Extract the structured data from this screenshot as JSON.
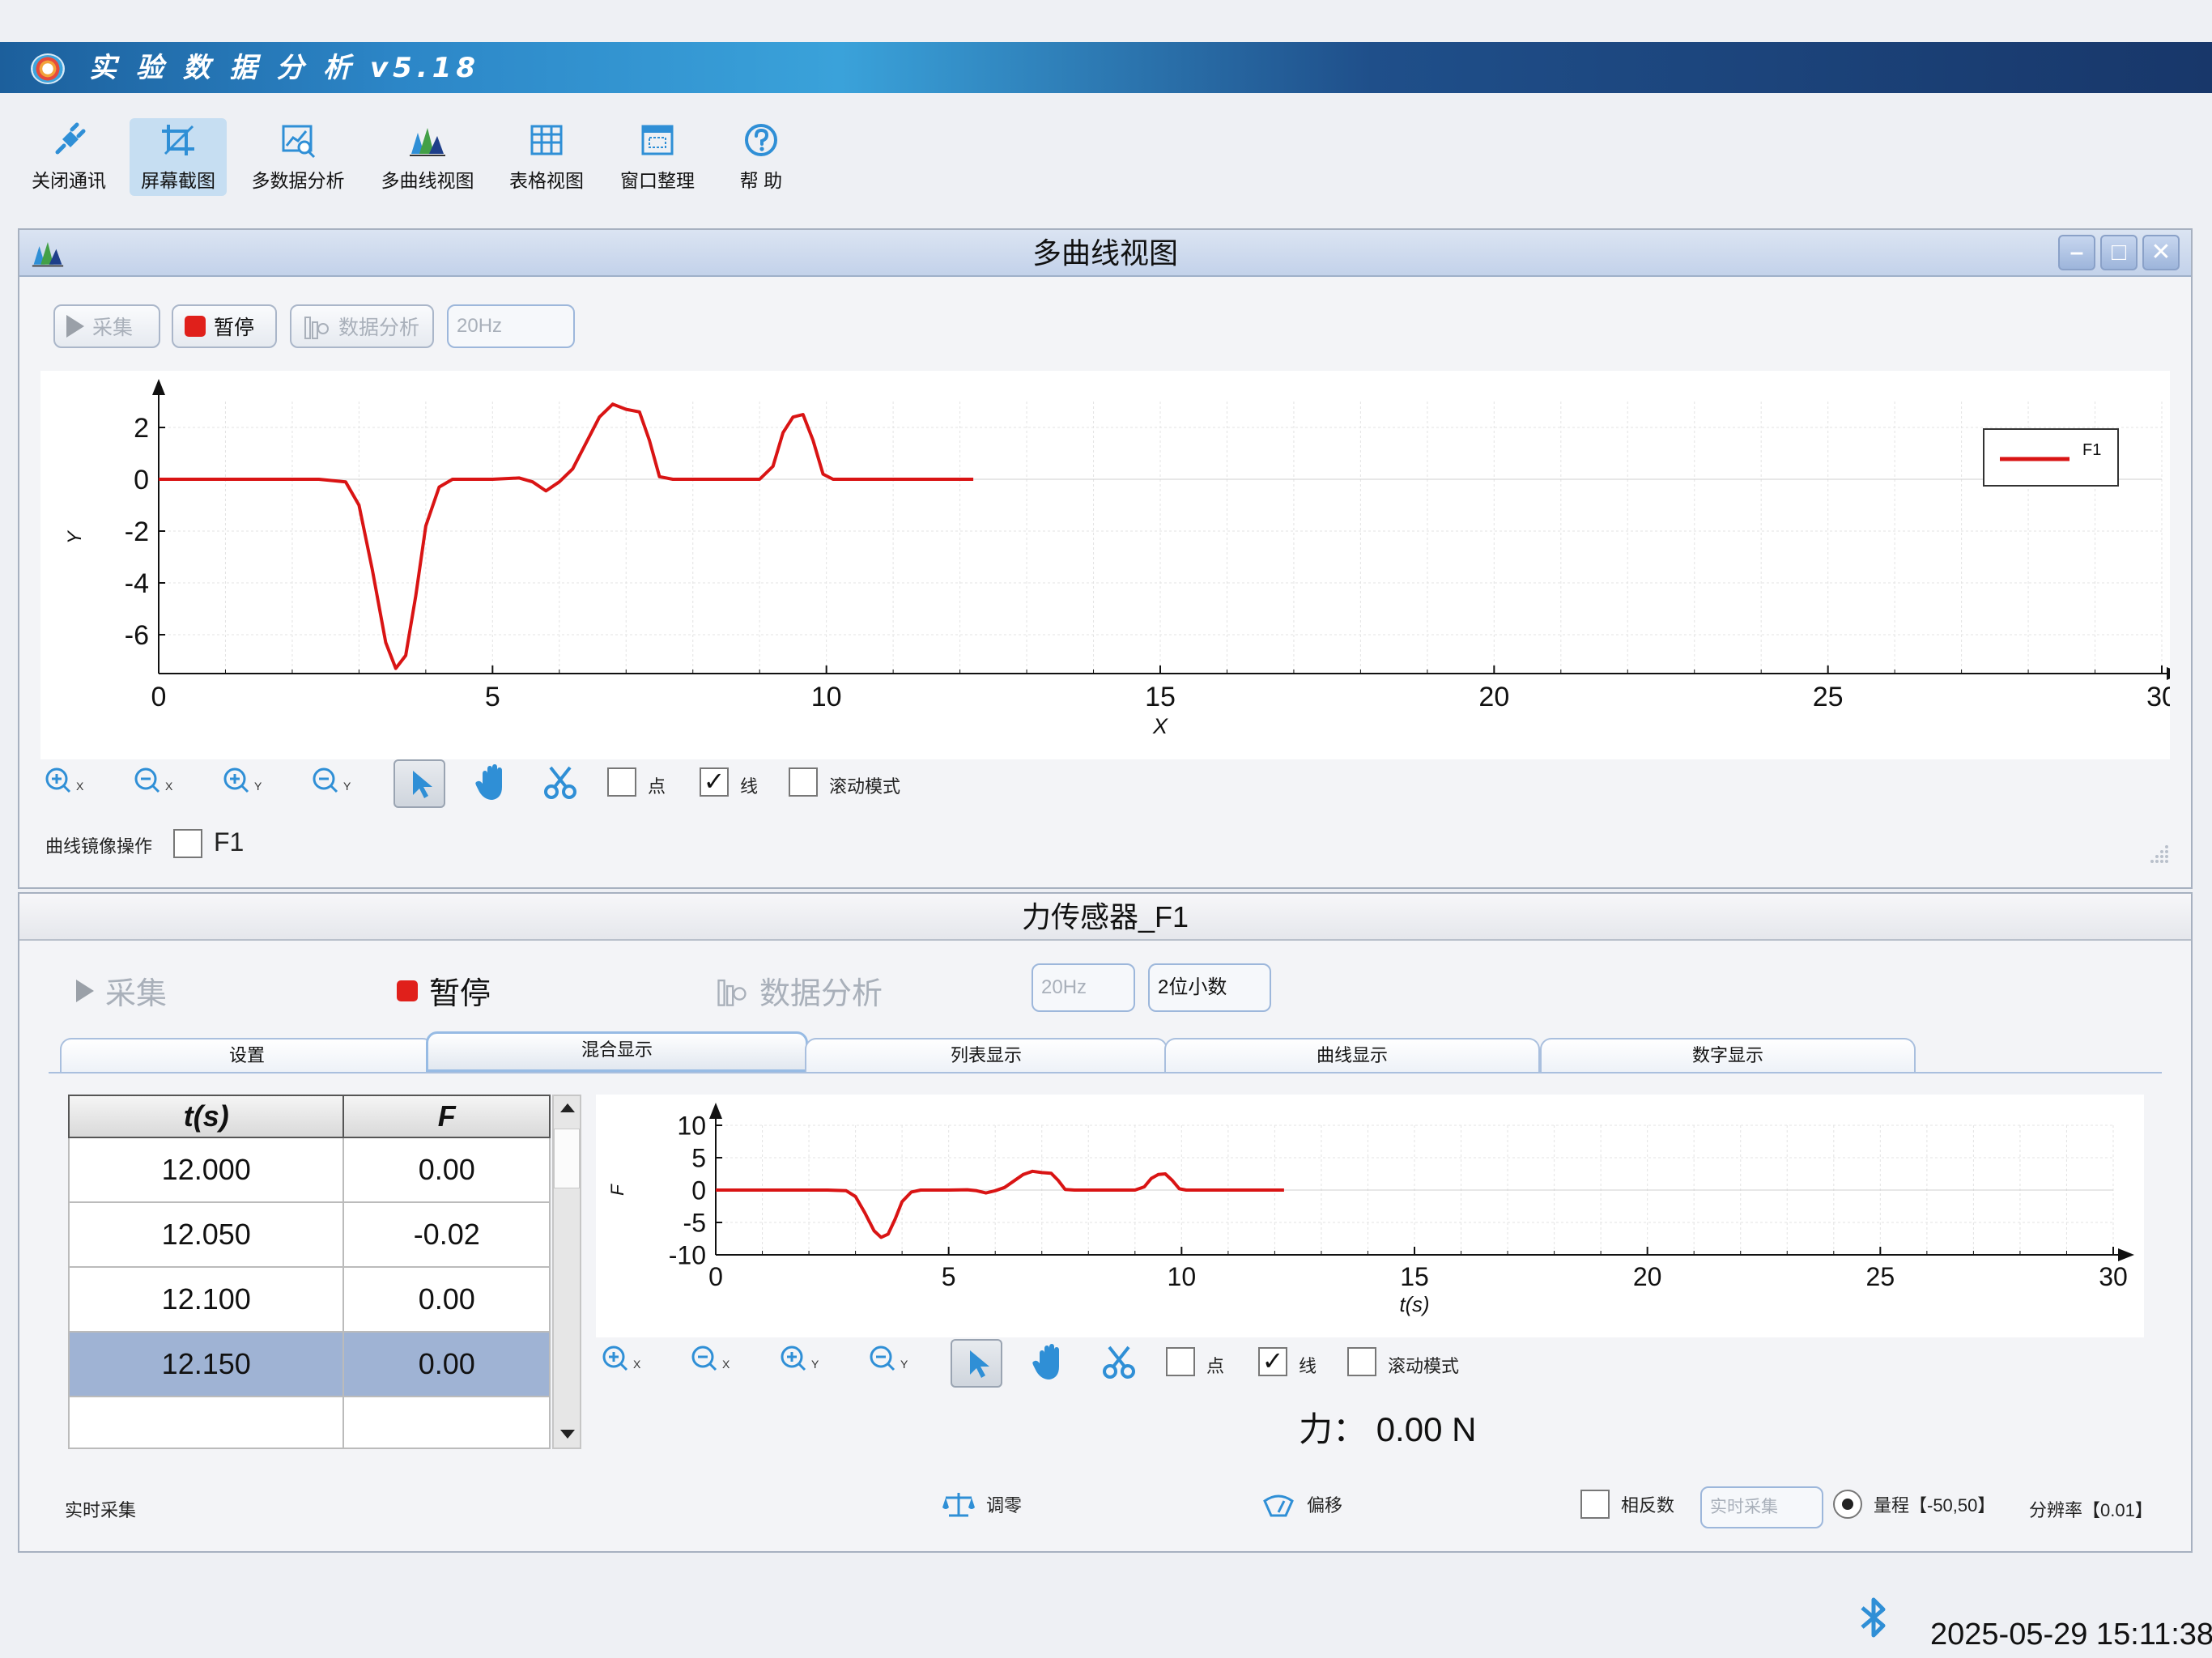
{
  "app": {
    "title": "实 验 数 据 分 析  v5.18"
  },
  "toolbar": {
    "items": [
      {
        "label": "关闭通讯",
        "icon": "plug-icon"
      },
      {
        "label": "屏幕截图",
        "icon": "crop-icon",
        "active": true
      },
      {
        "label": "多数据分析",
        "icon": "chart-search-icon"
      },
      {
        "label": "多曲线视图",
        "icon": "multi-curve-icon"
      },
      {
        "label": "表格视图",
        "icon": "table-icon"
      },
      {
        "label": "窗口整理",
        "icon": "window-arrange-icon"
      },
      {
        "label": "帮 助",
        "icon": "help-icon"
      }
    ]
  },
  "multi_curve_panel": {
    "title": "多曲线视图",
    "buttons": {
      "collect": "采集",
      "pause": "暂停",
      "analysis": "数据分析",
      "freq": "20Hz"
    },
    "controls": {
      "point": "点",
      "line": "线",
      "scroll": "滚动模式",
      "x": "X",
      "y": "Y"
    },
    "mirror_label": "曲线镜像操作",
    "mirror_series": "F1"
  },
  "sensor_panel": {
    "title": "力传感器_F1",
    "buttons": {
      "collect": "采集",
      "pause": "暂停",
      "analysis": "数据分析",
      "freq": "20Hz",
      "decimals": "2位小数"
    },
    "tabs": [
      "设置",
      "混合显示",
      "列表显示",
      "曲线显示",
      "数字显示"
    ],
    "active_tab": 1,
    "table": {
      "headers": [
        "t(s)",
        "F"
      ],
      "rows": [
        [
          "12.000",
          "0.00"
        ],
        [
          "12.050",
          "-0.02"
        ],
        [
          "12.100",
          "0.00"
        ],
        [
          "12.150",
          "0.00"
        ]
      ],
      "selected_row": 3
    },
    "controls": {
      "point": "点",
      "line": "线",
      "scroll": "滚动模式",
      "x": "X",
      "y": "Y"
    },
    "force_label": "力：",
    "force_value": "0.00 N",
    "status": {
      "realtime": "实时采集",
      "zero": "调零",
      "offset": "偏移",
      "invert": "相反数",
      "realtime_field": "实时采集",
      "range": "量程【-50,50】",
      "resolution": "分辨率【0.01】"
    }
  },
  "footer": {
    "datetime": "2025-05-29 15:11:38"
  },
  "colors": {
    "series": "#d91414",
    "accent": "#2f8fd6",
    "titlebar": "#1f4f8a"
  },
  "chart_data": [
    {
      "type": "line",
      "xlabel": "X",
      "ylabel": "Y",
      "xlim": [
        0,
        30
      ],
      "ylim": [
        -7.5,
        3
      ],
      "xticks": [
        0,
        5,
        10,
        15,
        20,
        25,
        30
      ],
      "yticks": [
        2,
        0,
        -2,
        -4,
        -6
      ],
      "legend": "top-right",
      "grid": true,
      "series": [
        {
          "name": "F1",
          "color": "#d91414",
          "points": [
            [
              0,
              0
            ],
            [
              2.4,
              0
            ],
            [
              2.8,
              -0.1
            ],
            [
              3.0,
              -1.0
            ],
            [
              3.2,
              -3.5
            ],
            [
              3.4,
              -6.3
            ],
            [
              3.55,
              -7.3
            ],
            [
              3.7,
              -6.8
            ],
            [
              3.85,
              -4.5
            ],
            [
              4.0,
              -1.8
            ],
            [
              4.2,
              -0.3
            ],
            [
              4.4,
              0
            ],
            [
              5.0,
              0
            ],
            [
              5.4,
              0.05
            ],
            [
              5.6,
              -0.1
            ],
            [
              5.8,
              -0.45
            ],
            [
              6.0,
              -0.1
            ],
            [
              6.2,
              0.4
            ],
            [
              6.4,
              1.4
            ],
            [
              6.6,
              2.4
            ],
            [
              6.8,
              2.9
            ],
            [
              7.0,
              2.7
            ],
            [
              7.2,
              2.6
            ],
            [
              7.35,
              1.5
            ],
            [
              7.5,
              0.1
            ],
            [
              7.7,
              0
            ],
            [
              9.0,
              0
            ],
            [
              9.2,
              0.5
            ],
            [
              9.35,
              1.8
            ],
            [
              9.5,
              2.4
            ],
            [
              9.65,
              2.5
            ],
            [
              9.8,
              1.5
            ],
            [
              9.95,
              0.2
            ],
            [
              10.1,
              0
            ],
            [
              12.2,
              0
            ]
          ]
        }
      ]
    },
    {
      "type": "line",
      "xlabel": "t(s)",
      "ylabel": "F",
      "xlim": [
        0,
        30
      ],
      "ylim": [
        -10,
        10
      ],
      "xticks": [
        0,
        5,
        10,
        15,
        20,
        25,
        30
      ],
      "yticks": [
        10,
        5,
        0,
        -5,
        -10
      ],
      "grid": true,
      "series": [
        {
          "name": "F1",
          "color": "#d91414",
          "points": [
            [
              0,
              0
            ],
            [
              2.4,
              0
            ],
            [
              2.8,
              -0.1
            ],
            [
              3.0,
              -1.0
            ],
            [
              3.2,
              -3.5
            ],
            [
              3.4,
              -6.3
            ],
            [
              3.55,
              -7.3
            ],
            [
              3.7,
              -6.8
            ],
            [
              3.85,
              -4.5
            ],
            [
              4.0,
              -1.8
            ],
            [
              4.2,
              -0.3
            ],
            [
              4.4,
              0
            ],
            [
              5.0,
              0
            ],
            [
              5.4,
              0.05
            ],
            [
              5.6,
              -0.1
            ],
            [
              5.8,
              -0.45
            ],
            [
              6.0,
              -0.1
            ],
            [
              6.2,
              0.4
            ],
            [
              6.4,
              1.4
            ],
            [
              6.6,
              2.4
            ],
            [
              6.8,
              2.9
            ],
            [
              7.0,
              2.7
            ],
            [
              7.2,
              2.6
            ],
            [
              7.35,
              1.5
            ],
            [
              7.5,
              0.1
            ],
            [
              7.7,
              0
            ],
            [
              9.0,
              0
            ],
            [
              9.2,
              0.5
            ],
            [
              9.35,
              1.8
            ],
            [
              9.5,
              2.4
            ],
            [
              9.65,
              2.5
            ],
            [
              9.8,
              1.5
            ],
            [
              9.95,
              0.2
            ],
            [
              10.1,
              0
            ],
            [
              12.2,
              0
            ]
          ]
        }
      ]
    }
  ]
}
